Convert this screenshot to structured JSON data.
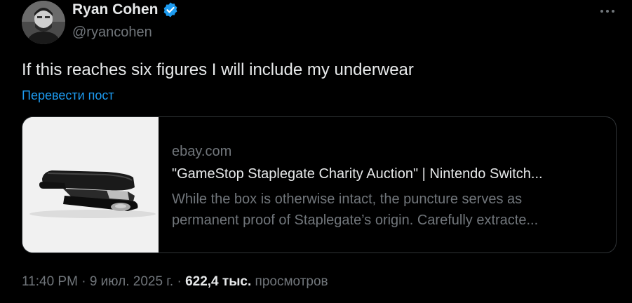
{
  "author": {
    "display_name": "Ryan Cohen",
    "handle": "@ryancohen",
    "verified_icon": "verified-badge-icon",
    "verified_color": "#1d9bf0"
  },
  "tweet": {
    "text": "If this reaches six figures I will include my underwear",
    "translate_label": "Перевести пост"
  },
  "card": {
    "domain": "ebay.com",
    "title": "\"GameStop Staplegate Charity Auction\" | Nintendo Switch...",
    "description_line1": "While the box is otherwise intact, the puncture serves as",
    "description_line2": "permanent proof of Staplegate’s origin. Carefully extracte...",
    "image_icon": "stapler-image"
  },
  "meta": {
    "time": "11:40 PM",
    "separator1": " · ",
    "date": "9 июл. 2025 г.",
    "separator2": " · ",
    "views_count": "622,4 тыс.",
    "views_label": " просмотров"
  },
  "menu_icon": "more-horizontal-icon",
  "colors": {
    "background": "#000000",
    "text_primary": "#e7e9ea",
    "text_secondary": "#71767b",
    "accent": "#1d9bf0",
    "border": "#2f3336"
  }
}
